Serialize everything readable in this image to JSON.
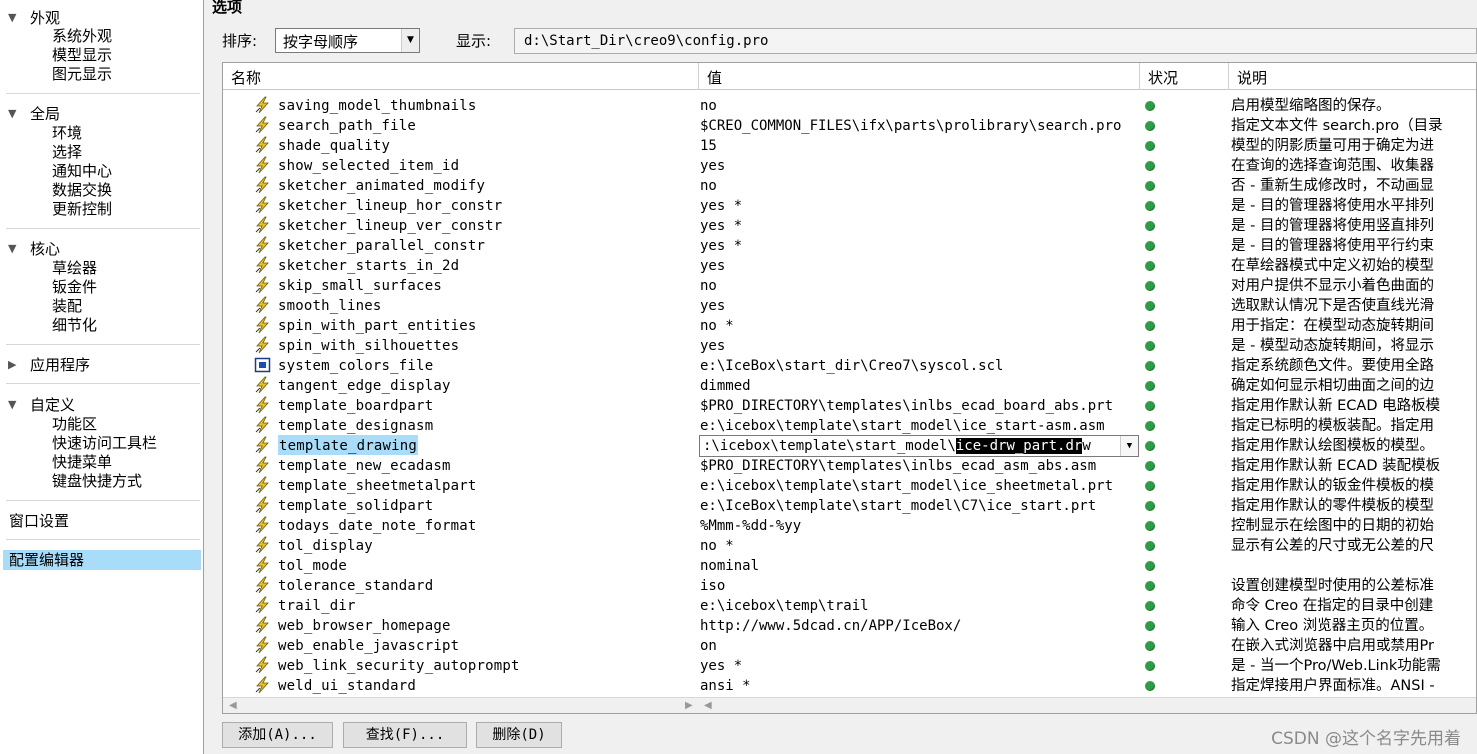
{
  "left_tree": {
    "appearance": {
      "label": "外观",
      "items": [
        "系统外观",
        "模型显示",
        "图元显示"
      ]
    },
    "global": {
      "label": "全局",
      "items": [
        "环境",
        "选择",
        "通知中心",
        "数据交换",
        "更新控制"
      ]
    },
    "core": {
      "label": "核心",
      "items": [
        "草绘器",
        "钣金件",
        "装配",
        "细节化"
      ]
    },
    "applications": {
      "label": "应用程序"
    },
    "customize": {
      "label": "自定义",
      "items": [
        "功能区",
        "快速访问工具栏",
        "快捷菜单",
        "键盘快捷方式"
      ]
    },
    "window_settings": "窗口设置",
    "config_editor": "配置编辑器"
  },
  "panel": {
    "title": "选项",
    "sort_label": "排序:",
    "sort_value": "按字母顺序",
    "display_label": "显示:",
    "display_path": "d:\\Start_Dir\\creo9\\config.pro"
  },
  "table": {
    "headers": {
      "name": "名称",
      "value": "值",
      "status": "状况",
      "description": "说明"
    },
    "rows": [
      {
        "name": "saving_model_thumbnails",
        "value": "no",
        "icon": "lightning-icon",
        "desc": "启用模型缩略图的保存。"
      },
      {
        "name": "search_path_file",
        "value": "$CREO_COMMON_FILES\\ifx\\parts\\prolibrary\\search.pro",
        "icon": "lightning-icon",
        "desc": "指定文本文件 search.pro（目录"
      },
      {
        "name": "shade_quality",
        "value": "15",
        "icon": "lightning-icon",
        "desc": "模型的阴影质量可用于确定为进"
      },
      {
        "name": "show_selected_item_id",
        "value": "yes",
        "icon": "lightning-icon",
        "desc": "在查询的选择查询范围、收集器"
      },
      {
        "name": "sketcher_animated_modify",
        "value": "no",
        "icon": "lightning-icon",
        "desc": "否 - 重新生成修改时，不动画显"
      },
      {
        "name": "sketcher_lineup_hor_constr",
        "value": "yes *",
        "icon": "lightning-icon",
        "desc": "是 - 目的管理器将使用水平排列"
      },
      {
        "name": "sketcher_lineup_ver_constr",
        "value": "yes *",
        "icon": "lightning-icon",
        "desc": "是 - 目的管理器将使用竖直排列"
      },
      {
        "name": "sketcher_parallel_constr",
        "value": "yes *",
        "icon": "lightning-icon",
        "desc": "是 - 目的管理器将使用平行约束"
      },
      {
        "name": "sketcher_starts_in_2d",
        "value": "yes",
        "icon": "lightning-icon",
        "desc": "在草绘器模式中定义初始的模型"
      },
      {
        "name": "skip_small_surfaces",
        "value": "no",
        "icon": "lightning-icon",
        "desc": "对用户提供不显示小着色曲面的"
      },
      {
        "name": "smooth_lines",
        "value": "yes",
        "icon": "lightning-icon",
        "desc": "选取默认情况下是否使直线光滑"
      },
      {
        "name": "spin_with_part_entities",
        "value": "no *",
        "icon": "lightning-icon",
        "desc": "用于指定：在模型动态旋转期间"
      },
      {
        "name": "spin_with_silhouettes",
        "value": "yes",
        "icon": "lightning-icon",
        "desc": "是 - 模型动态旋转期间，将显示"
      },
      {
        "name": "system_colors_file",
        "value": "e:\\IceBox\\start_dir\\Creo7\\syscol.scl",
        "icon": "window-icon",
        "desc": "指定系统颜色文件。要使用全路"
      },
      {
        "name": "tangent_edge_display",
        "value": "dimmed",
        "icon": "lightning-icon",
        "desc": "确定如何显示相切曲面之间的边"
      },
      {
        "name": "template_boardpart",
        "value": "$PRO_DIRECTORY\\templates\\inlbs_ecad_board_abs.prt",
        "icon": "lightning-icon",
        "desc": "指定用作默认新 ECAD 电路板模"
      },
      {
        "name": "template_designasm",
        "value": "e:\\icebox\\template\\start_model\\ice_start-asm.asm",
        "icon": "lightning-icon",
        "desc": "指定已标明的模板装配。指定用"
      },
      {
        "name": "template_drawing",
        "value": "",
        "icon": "lightning-icon",
        "desc": "指定用作默认绘图模板的模型。"
      },
      {
        "name": "template_new_ecadasm",
        "value": "$PRO_DIRECTORY\\templates\\inlbs_ecad_asm_abs.asm",
        "icon": "lightning-icon",
        "desc": "指定用作默认新 ECAD 装配模板"
      },
      {
        "name": "template_sheetmetalpart",
        "value": "e:\\icebox\\template\\start_model\\ice_sheetmetal.prt",
        "icon": "lightning-icon",
        "desc": "指定用作默认的钣金件模板的模"
      },
      {
        "name": "template_solidpart",
        "value": "e:\\IceBox\\template\\start_model\\C7\\ice_start.prt",
        "icon": "lightning-icon",
        "desc": "指定用作默认的零件模板的模型"
      },
      {
        "name": "todays_date_note_format",
        "value": "%Mmm-%dd-%yy",
        "icon": "lightning-icon",
        "desc": "控制显示在绘图中的日期的初始"
      },
      {
        "name": "tol_display",
        "value": "no *",
        "icon": "lightning-icon",
        "desc": "显示有公差的尺寸或无公差的尺"
      },
      {
        "name": "tol_mode",
        "value": "nominal",
        "icon": "lightning-icon",
        "desc": ""
      },
      {
        "name": "tolerance_standard",
        "value": "iso",
        "icon": "lightning-icon",
        "desc": "设置创建模型时使用的公差标准"
      },
      {
        "name": "trail_dir",
        "value": "e:\\icebox\\temp\\trail",
        "icon": "lightning-icon",
        "desc": "命令 Creo 在指定的目录中创建"
      },
      {
        "name": "web_browser_homepage",
        "value": "http://www.5dcad.cn/APP/IceBox/",
        "icon": "lightning-icon",
        "desc": "输入 Creo 浏览器主页的位置。"
      },
      {
        "name": "web_enable_javascript",
        "value": "on",
        "icon": "lightning-icon",
        "desc": "在嵌入式浏览器中启用或禁用Pr"
      },
      {
        "name": "web_link_security_autoprompt",
        "value": "yes *",
        "icon": "lightning-icon",
        "desc": "是 - 当一个Pro/Web.Link功能需"
      },
      {
        "name": "weld_ui_standard",
        "value": "ansi *",
        "icon": "lightning-icon",
        "desc": "指定焊接用户界面标准。ANSI -"
      }
    ],
    "editing": {
      "before": ":\\icebox\\template\\start_model\\",
      "selected": "ice-drw_part.dr",
      "after": "w"
    }
  },
  "buttons": {
    "add": "添加(A)...",
    "find": "查找(F)...",
    "delete": "删除(D)"
  },
  "watermark": "CSDN @这个名字先用着",
  "colors": {
    "status_ok": "#2e9e46",
    "selection": "#a8dcf8",
    "lightning": "#e8c020"
  }
}
